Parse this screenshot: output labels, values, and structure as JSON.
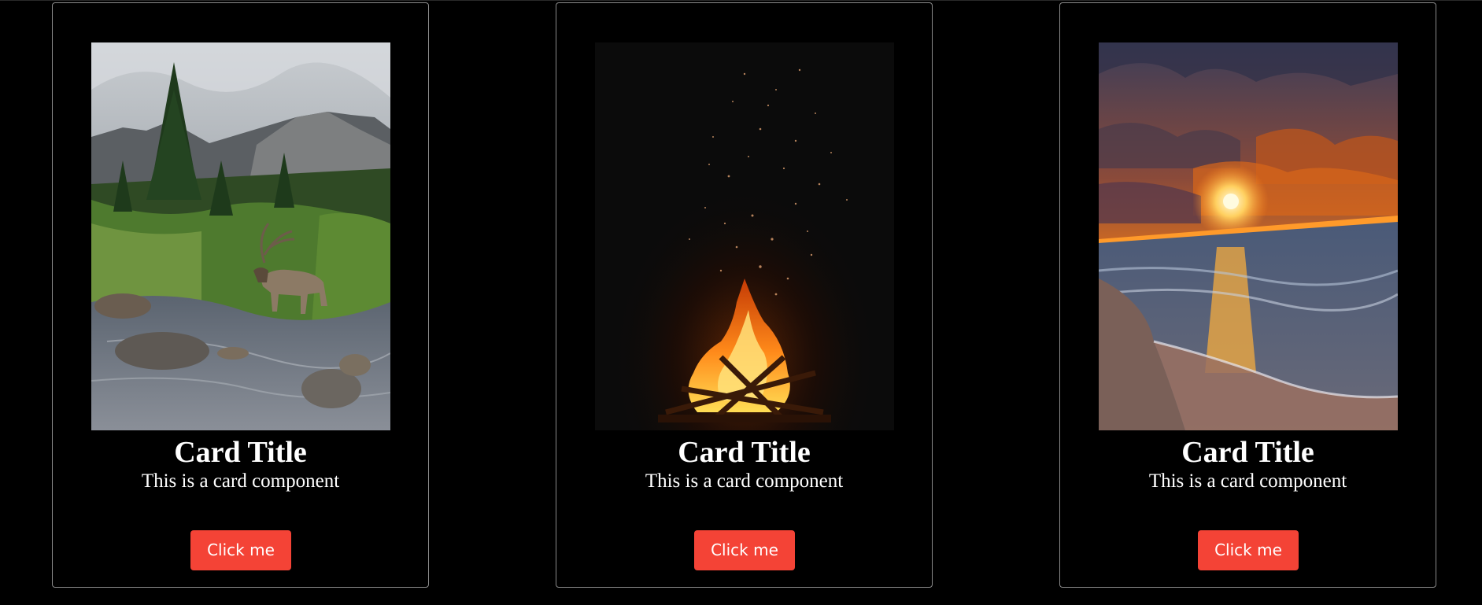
{
  "cards": [
    {
      "image_name": "elk-in-mountain-stream",
      "title": "Card Title",
      "description": "This is a card component",
      "button_label": "Click me"
    },
    {
      "image_name": "campfire-with-sparks",
      "title": "Card Title",
      "description": "This is a card component",
      "button_label": "Click me"
    },
    {
      "image_name": "beach-sunset",
      "title": "Card Title",
      "description": "This is a card component",
      "button_label": "Click me"
    }
  ],
  "colors": {
    "background": "#000000",
    "card_border": "#8a8a8a",
    "button": "#f44336",
    "text": "#ffffff"
  }
}
